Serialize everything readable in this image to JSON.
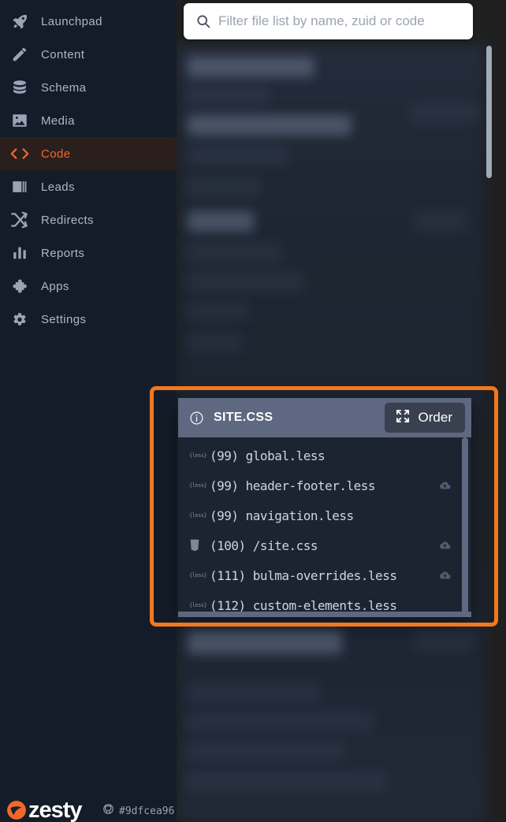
{
  "brand": {
    "name": "zesty",
    "logo_icon": "zesty-logo-icon"
  },
  "sidebar": {
    "items": [
      {
        "label": "Launchpad",
        "icon": "rocket-icon",
        "key": "launchpad",
        "active": false
      },
      {
        "label": "Content",
        "icon": "pencil-icon",
        "key": "content",
        "active": false
      },
      {
        "label": "Schema",
        "icon": "database-icon",
        "key": "schema",
        "active": false
      },
      {
        "label": "Media",
        "icon": "image-icon",
        "key": "media",
        "active": false
      },
      {
        "label": "Code",
        "icon": "code-brackets-icon",
        "key": "code",
        "active": true
      },
      {
        "label": "Leads",
        "icon": "contact-card-icon",
        "key": "leads",
        "active": false
      },
      {
        "label": "Redirects",
        "icon": "shuffle-icon",
        "key": "redirects",
        "active": false
      },
      {
        "label": "Reports",
        "icon": "bar-chart-icon",
        "key": "reports",
        "active": false
      },
      {
        "label": "Apps",
        "icon": "puzzle-icon",
        "key": "apps",
        "active": false
      },
      {
        "label": "Settings",
        "icon": "gear-icon",
        "key": "settings",
        "active": false
      }
    ],
    "active_key": "code",
    "active_color": "#f2682a",
    "active_bg": "#2b1f1d",
    "text_color": "#aeb6c4"
  },
  "search": {
    "placeholder": "Filter file list by name, zuid or code",
    "value": "",
    "icon": "search-icon"
  },
  "highlight": {
    "color": "#f2781f",
    "border_width_px": 5
  },
  "panel": {
    "info_icon": "info-circle-icon",
    "title": "SITE.CSS",
    "header_bg": "#5e6880",
    "body_bg": "#1c2431",
    "order_button": {
      "label": "Order",
      "icon": "expand-arrows-icon",
      "bg": "#39404f"
    },
    "files": [
      {
        "type_badge": "{less}",
        "type_icon": "less-file-icon",
        "name": "(99) global.less",
        "cloud": false
      },
      {
        "type_badge": "{less}",
        "type_icon": "less-file-icon",
        "name": "(99) header-footer.less",
        "cloud": true
      },
      {
        "type_badge": "{less}",
        "type_icon": "less-file-icon",
        "name": "(99) navigation.less",
        "cloud": false
      },
      {
        "type_badge": "",
        "type_icon": "css3-file-icon",
        "name": "(100) /site.css",
        "cloud": true
      },
      {
        "type_badge": "{less}",
        "type_icon": "less-file-icon",
        "name": "(111) bulma-overrides.less",
        "cloud": true
      },
      {
        "type_badge": "{less}",
        "type_icon": "less-file-icon",
        "name": "(112) custom-elements.less",
        "cloud": false
      }
    ],
    "cloud_icon": "cloud-upload-icon",
    "scrollbar": "panel-scrollbar"
  },
  "footer": {
    "version_icon": "github-icon",
    "version": "#9dfcea96"
  }
}
